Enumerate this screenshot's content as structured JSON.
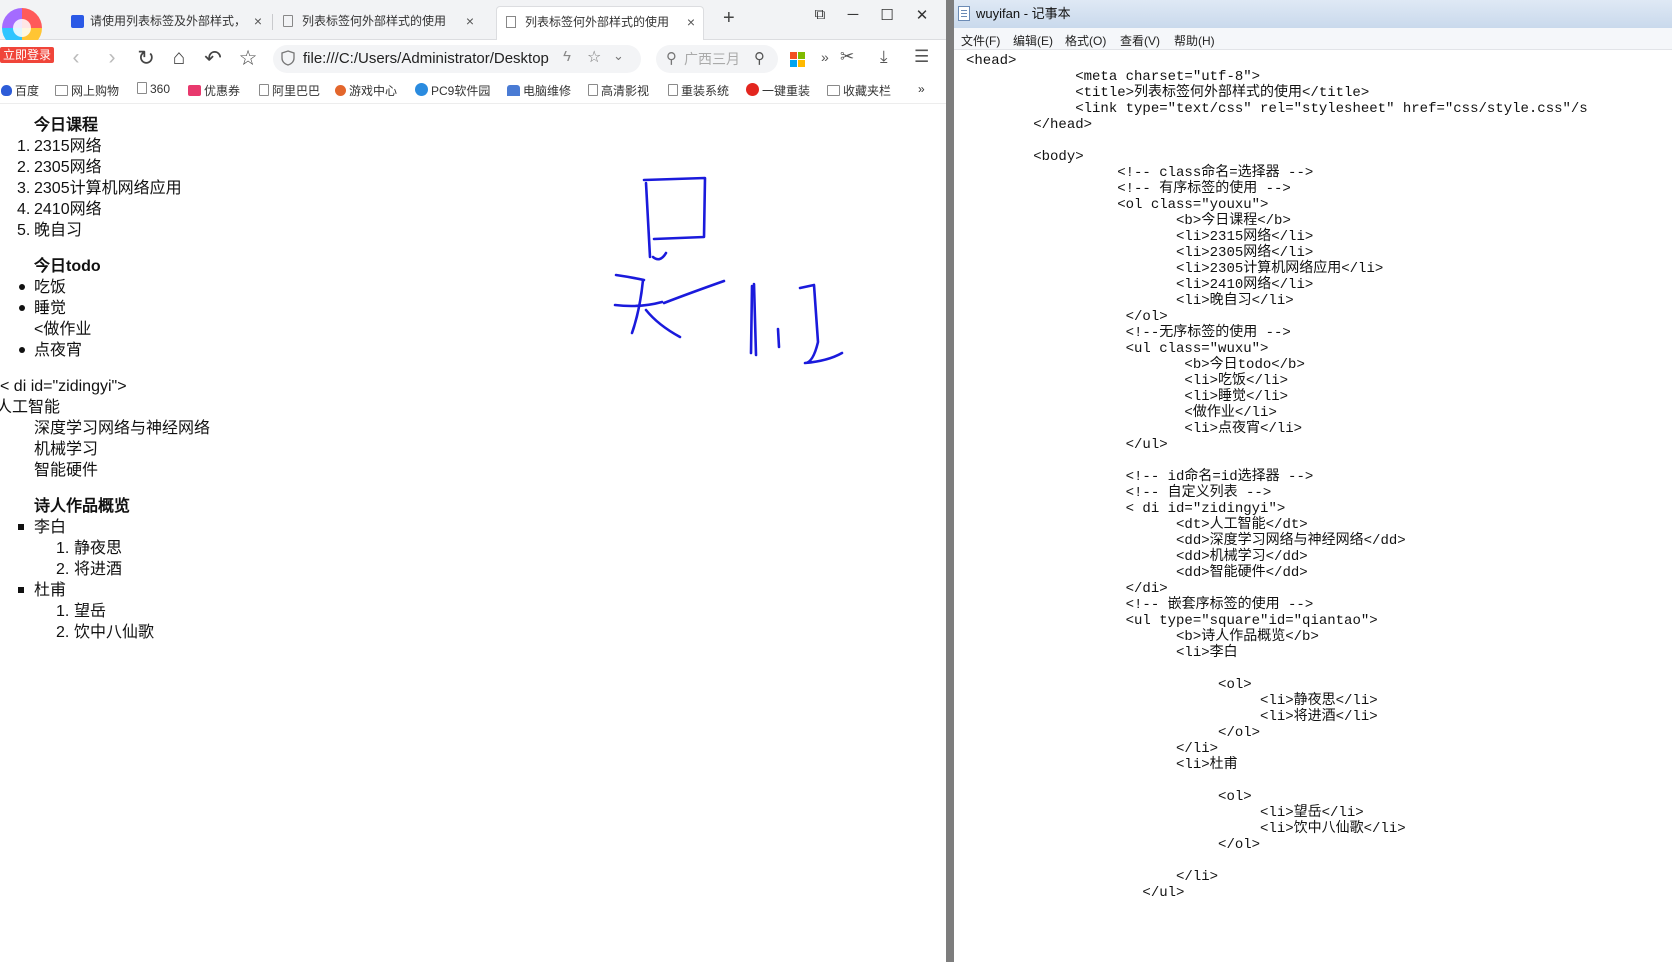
{
  "browser": {
    "login_badge": "立即登录",
    "tabs": [
      {
        "title": "请使用列表标签及外部样式，",
        "close": "×"
      },
      {
        "title": "列表标签何外部样式的使用",
        "close": "×"
      },
      {
        "title": "列表标签何外部样式的使用",
        "close": "×"
      }
    ],
    "new_tab": "+",
    "window_controls": {
      "skin": "⧉",
      "minimize": "─",
      "maximize": "☐",
      "close": "✕"
    },
    "nav": {
      "back": "‹",
      "forward": "›",
      "reload": "↻",
      "home": "⌂",
      "undo": "↶",
      "favorite": "☆"
    },
    "url": "file:///C:/Users/Administrator/Desktop",
    "url_icons": {
      "flash": "ϟ",
      "star": "☆",
      "chevron": "⌄"
    },
    "search": {
      "placeholder": "广西三月",
      "mag": "⚲",
      "btn": "⚲"
    },
    "toolbar_icons": {
      "more": "»",
      "scissors": "✂",
      "download": "⤓",
      "menu": "☰"
    },
    "bookmarks": [
      {
        "label": "百度",
        "icon": "baidu-icon"
      },
      {
        "label": "网上购物",
        "icon": "folder-icon"
      },
      {
        "label": "360",
        "icon": "page-icon"
      },
      {
        "label": "优惠券",
        "icon": "coupon-icon"
      },
      {
        "label": "阿里巴巴",
        "icon": "page-icon"
      },
      {
        "label": "游戏中心",
        "icon": "game-icon"
      },
      {
        "label": "PC9软件园",
        "icon": "pc9-icon"
      },
      {
        "label": "电脑维修",
        "icon": "repair-icon"
      },
      {
        "label": "高清影视",
        "icon": "page-icon"
      },
      {
        "label": "重装系统",
        "icon": "page-icon"
      },
      {
        "label": "一键重装",
        "icon": "tomato-icon"
      },
      {
        "label": "收藏夹栏",
        "icon": "folder-icon"
      }
    ],
    "bookmarks_more": "»"
  },
  "page": {
    "ol_title": "今日课程",
    "ol_items": [
      "2315网络",
      "2305网络",
      "2305计算机网络应用",
      "2410网络",
      "晚自习"
    ],
    "ol_numbers": [
      "1.",
      "2.",
      "3.",
      "4.",
      "5."
    ],
    "ul_title": "今日todo",
    "ul_items": [
      "吃饭",
      "睡觉"
    ],
    "ul_text": "<做作业",
    "ul_last": "点夜宵",
    "di_text": "< di id=\"zidingyi\">",
    "dt": "人工智能",
    "dd": [
      "深度学习网络与神经网络",
      "机械学习",
      "智能硬件"
    ],
    "poet_title": "诗人作品概览",
    "poets": [
      {
        "name": "李白",
        "works": [
          "静夜思",
          "将进酒"
        ]
      },
      {
        "name": "杜甫",
        "works": [
          "望岳",
          "饮中八仙歌"
        ]
      }
    ],
    "work_numbers": [
      "1.",
      "2."
    ]
  },
  "notepad": {
    "title": "wuyifan - 记事本",
    "menu": [
      "文件(F)",
      "编辑(E)",
      "格式(O)",
      "查看(V)",
      "帮助(H)"
    ],
    "code": [
      "<head>",
      "             <meta charset=\"utf-8\">",
      "             <title>列表标签何外部样式的使用</title>",
      "             <link type=\"text/css\" rel=\"stylesheet\" href=\"css/style.css\"/s",
      "        </head>",
      "",
      "        <body>",
      "                  <!-- class命名=选择器 -->",
      "                  <!-- 有序标签的使用 -->",
      "                  <ol class=\"youxu\">",
      "                         <b>今日课程</b>",
      "                         <li>2315网络</li>",
      "                         <li>2305网络</li>",
      "                         <li>2305计算机网络应用</li>",
      "                         <li>2410网络</li>",
      "                         <li>晚自习</li>",
      "                   </ol>",
      "                   <!--无序标签的使用 -->",
      "                   <ul class=\"wuxu\">",
      "                          <b>今日todo</b>",
      "                          <li>吃饭</li>",
      "                          <li>睡觉</li>",
      "                          <做作业</li>",
      "                          <li>点夜宵</li>",
      "                   </ul>",
      "",
      "                   <!-- id命名=id选择器 -->",
      "                   <!-- 自定义列表 -->",
      "                   < di id=\"zidingyi\">",
      "                         <dt>人工智能</dt>",
      "                         <dd>深度学习网络与神经网络</dd>",
      "                         <dd>机械学习</dd>",
      "                         <dd>智能硬件</dd>",
      "                   </di>",
      "                   <!-- 嵌套序标签的使用 -->",
      "                   <ul type=\"square\"id=\"qiantao\">",
      "                         <b>诗人作品概览</b>",
      "                         <li>李白",
      "",
      "                              <ol>",
      "                                   <li>静夜思</li>",
      "                                   <li>将进酒</li>",
      "                              </ol>",
      "                         </li>",
      "                         <li>杜甫",
      "",
      "                              <ol>",
      "                                   <li>望岳</li>",
      "                                   <li>饮中八仙歌</li>",
      "                              </ol>",
      "",
      "                         </li>",
      "                     </ul>"
    ]
  },
  "colors": {
    "ink": "#1a1adc",
    "badge": "#f0453a"
  }
}
